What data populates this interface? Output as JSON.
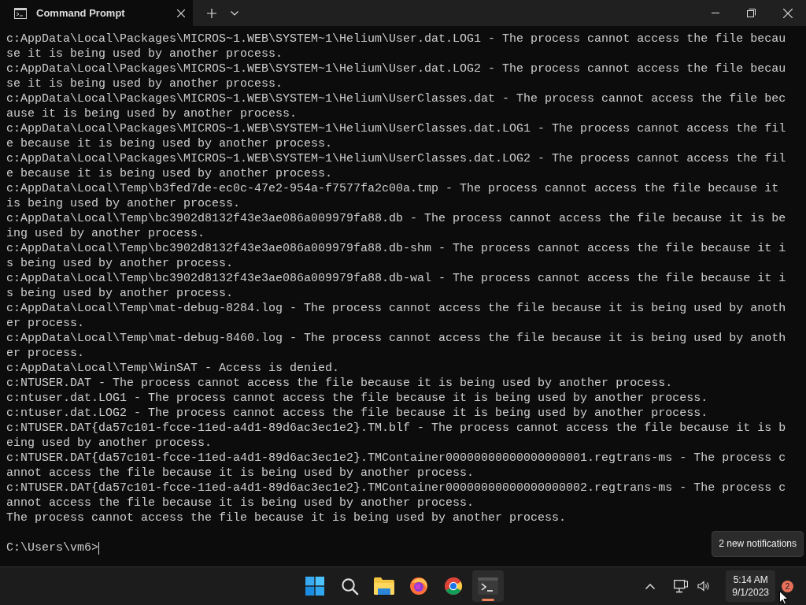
{
  "window": {
    "tabs": [
      {
        "title": "Command Prompt",
        "selected": true
      }
    ]
  },
  "terminal": {
    "lines": [
      "c:AppData\\Local\\Packages\\MICROS~1.WEB\\SYSTEM~1\\Helium\\User.dat.LOG1 - The process cannot access the file becau",
      "se it is being used by another process.",
      "c:AppData\\Local\\Packages\\MICROS~1.WEB\\SYSTEM~1\\Helium\\User.dat.LOG2 - The process cannot access the file becau",
      "se it is being used by another process.",
      "c:AppData\\Local\\Packages\\MICROS~1.WEB\\SYSTEM~1\\Helium\\UserClasses.dat - The process cannot access the file bec",
      "ause it is being used by another process.",
      "c:AppData\\Local\\Packages\\MICROS~1.WEB\\SYSTEM~1\\Helium\\UserClasses.dat.LOG1 - The process cannot access the fil",
      "e because it is being used by another process.",
      "c:AppData\\Local\\Packages\\MICROS~1.WEB\\SYSTEM~1\\Helium\\UserClasses.dat.LOG2 - The process cannot access the fil",
      "e because it is being used by another process.",
      "c:AppData\\Local\\Temp\\b3fed7de-ec0c-47e2-954a-f7577fa2c00a.tmp - The process cannot access the file because it",
      "is being used by another process.",
      "c:AppData\\Local\\Temp\\bc3902d8132f43e3ae086a009979fa88.db - The process cannot access the file because it is be",
      "ing used by another process.",
      "c:AppData\\Local\\Temp\\bc3902d8132f43e3ae086a009979fa88.db-shm - The process cannot access the file because it i",
      "s being used by another process.",
      "c:AppData\\Local\\Temp\\bc3902d8132f43e3ae086a009979fa88.db-wal - The process cannot access the file because it i",
      "s being used by another process.",
      "c:AppData\\Local\\Temp\\mat-debug-8284.log - The process cannot access the file because it is being used by anoth",
      "er process.",
      "c:AppData\\Local\\Temp\\mat-debug-8460.log - The process cannot access the file because it is being used by anoth",
      "er process.",
      "c:AppData\\Local\\Temp\\WinSAT - Access is denied.",
      "c:NTUSER.DAT - The process cannot access the file because it is being used by another process.",
      "c:ntuser.dat.LOG1 - The process cannot access the file because it is being used by another process.",
      "c:ntuser.dat.LOG2 - The process cannot access the file because it is being used by another process.",
      "c:NTUSER.DAT{da57c101-fcce-11ed-a4d1-89d6ac3ec1e2}.TM.blf - The process cannot access the file because it is b",
      "eing used by another process.",
      "c:NTUSER.DAT{da57c101-fcce-11ed-a4d1-89d6ac3ec1e2}.TMContainer00000000000000000001.regtrans-ms - The process c",
      "annot access the file because it is being used by another process.",
      "c:NTUSER.DAT{da57c101-fcce-11ed-a4d1-89d6ac3ec1e2}.TMContainer00000000000000000002.regtrans-ms - The process c",
      "annot access the file because it is being used by another process.",
      "The process cannot access the file because it is being used by another process."
    ],
    "prompt": "C:\\Users\\vm6>"
  },
  "tooltip": "2 new notifications",
  "taskbar": {
    "apps": [
      {
        "kind": "start",
        "selected": false
      },
      {
        "kind": "search",
        "selected": false
      },
      {
        "kind": "files",
        "selected": false
      },
      {
        "kind": "firefox",
        "selected": false
      },
      {
        "kind": "chrome",
        "selected": false
      },
      {
        "kind": "terminal",
        "selected": true
      }
    ],
    "time": "5:14 AM",
    "date": "9/1/2023",
    "notification_count": "2"
  }
}
